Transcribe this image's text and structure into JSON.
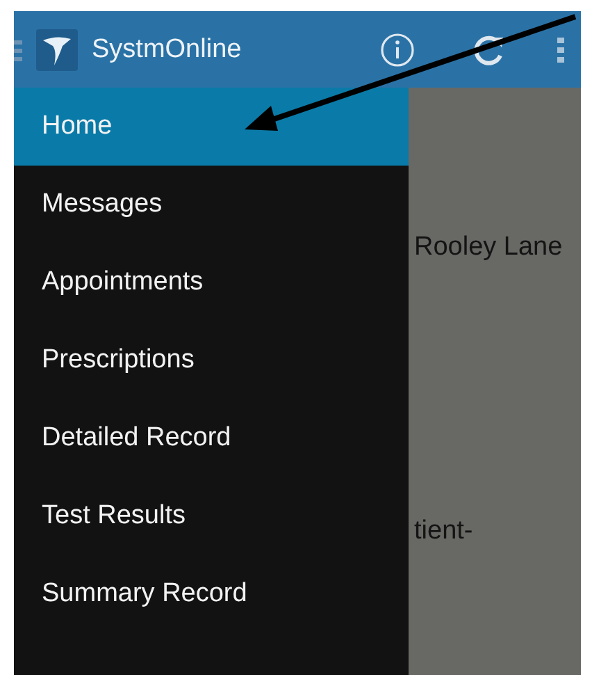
{
  "app_bar": {
    "title": "SystmOnline"
  },
  "drawer": {
    "items": [
      {
        "label": "Home",
        "selected": true
      },
      {
        "label": "Messages",
        "selected": false
      },
      {
        "label": "Appointments",
        "selected": false
      },
      {
        "label": "Prescriptions",
        "selected": false
      },
      {
        "label": "Detailed Record",
        "selected": false
      },
      {
        "label": "Test Results",
        "selected": false
      },
      {
        "label": "Summary Record",
        "selected": false
      }
    ]
  },
  "background_content": {
    "texts": [
      "Rooley Lane",
      "tient-"
    ]
  }
}
